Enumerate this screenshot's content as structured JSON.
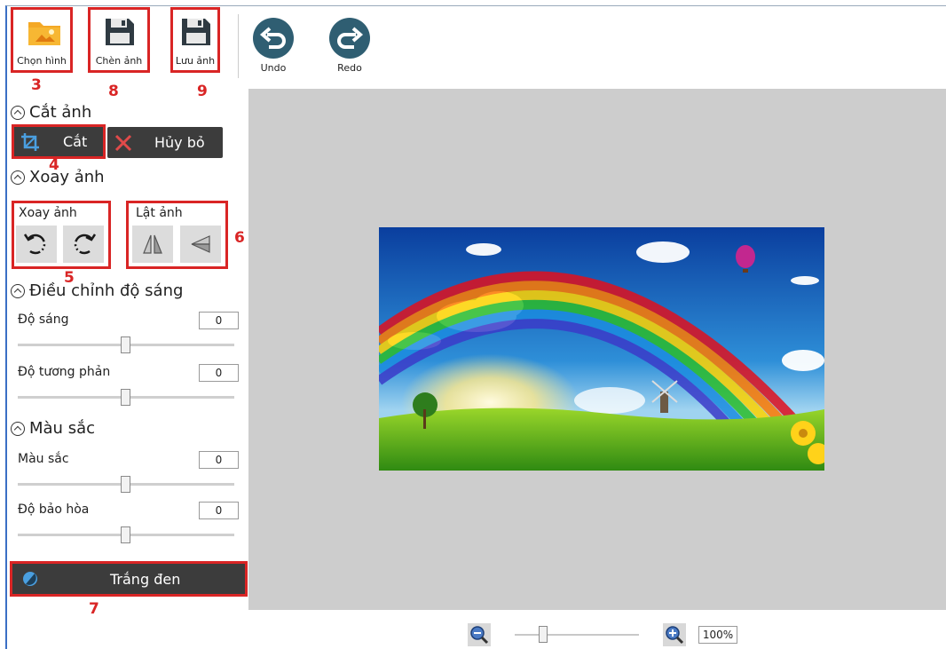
{
  "toolbar": {
    "open_label": "Chọn hình",
    "insert_label": "Chèn ảnh",
    "save_label": "Lưu ảnh",
    "undo_label": "Undo",
    "redo_label": "Redo"
  },
  "callouts": [
    "3",
    "8",
    "9",
    "4",
    "5",
    "6",
    "7"
  ],
  "crop": {
    "heading": "Cắt ảnh",
    "crop_label": "Cắt",
    "cancel_label": "Hủy bỏ"
  },
  "rotate": {
    "heading": "Xoay ảnh",
    "rotate_group": "Xoay ảnh",
    "flip_group": "Lật ảnh"
  },
  "brightness": {
    "heading": "Điều chỉnh độ sáng",
    "brightness_label": "Độ sáng",
    "brightness_value": "0",
    "contrast_label": "Độ tương phản",
    "contrast_value": "0"
  },
  "color": {
    "heading": "Màu sắc",
    "hue_label": "Màu sắc",
    "hue_value": "0",
    "saturation_label": "Độ bảo hòa",
    "saturation_value": "0"
  },
  "grayscale": {
    "label": "Trắng đen"
  },
  "zoom": {
    "value": "100%"
  },
  "colors": {
    "accent_red": "#d92525",
    "dark_button": "#3c3c3c",
    "circle_button": "#2f5e72",
    "canvas_bg": "#cdcdcd"
  }
}
